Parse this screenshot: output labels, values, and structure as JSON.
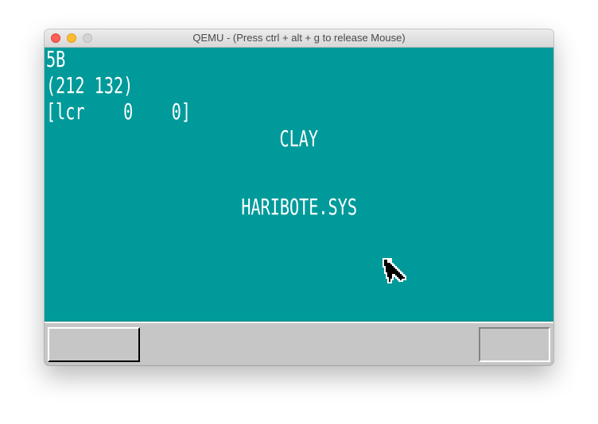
{
  "window": {
    "title": "QEMU - (Press ctrl + alt + g to release Mouse)"
  },
  "screen": {
    "debug_lines": [
      "5B",
      "(212 132)",
      "[lcr    0    0]"
    ],
    "labels": [
      "CLAY",
      "HARIBOTE.SYS"
    ],
    "desktop_color": "#009a9a",
    "taskbar_color": "#c6c6c6"
  },
  "icons": {
    "cursor": "mouse-pointer-icon"
  }
}
